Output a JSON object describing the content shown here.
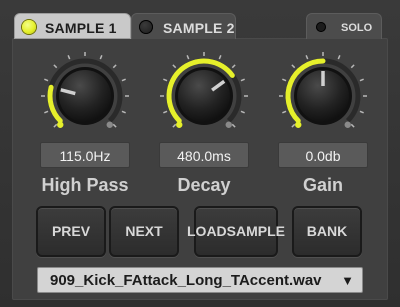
{
  "colors": {
    "accent": "#e6f02b",
    "panel": "#404040",
    "readout_bg": "#5a5a5a"
  },
  "tabs": [
    {
      "label": "SAMPLE 1",
      "active": true,
      "led": "on"
    },
    {
      "label": "SAMPLE 2",
      "active": false,
      "led": "off"
    }
  ],
  "solo": {
    "label": "SOLO",
    "led": "off"
  },
  "knobs": [
    {
      "name": "high-pass",
      "label": "High Pass",
      "value": "115.0Hz",
      "level": 0.22
    },
    {
      "name": "decay",
      "label": "Decay",
      "value": "480.0ms",
      "level": 0.7
    },
    {
      "name": "gain",
      "label": "Gain",
      "value": "0.0db",
      "level": 0.5
    }
  ],
  "buttons": {
    "prev": "PREV",
    "next": "NEXT",
    "load_sample": [
      "LOAD",
      "SAMPLE"
    ],
    "bank": "BANK"
  },
  "sample_select": {
    "value": "909_Kick_FAttack_Long_TAccent.wav",
    "arrow_icon": "triangle-down-icon"
  }
}
